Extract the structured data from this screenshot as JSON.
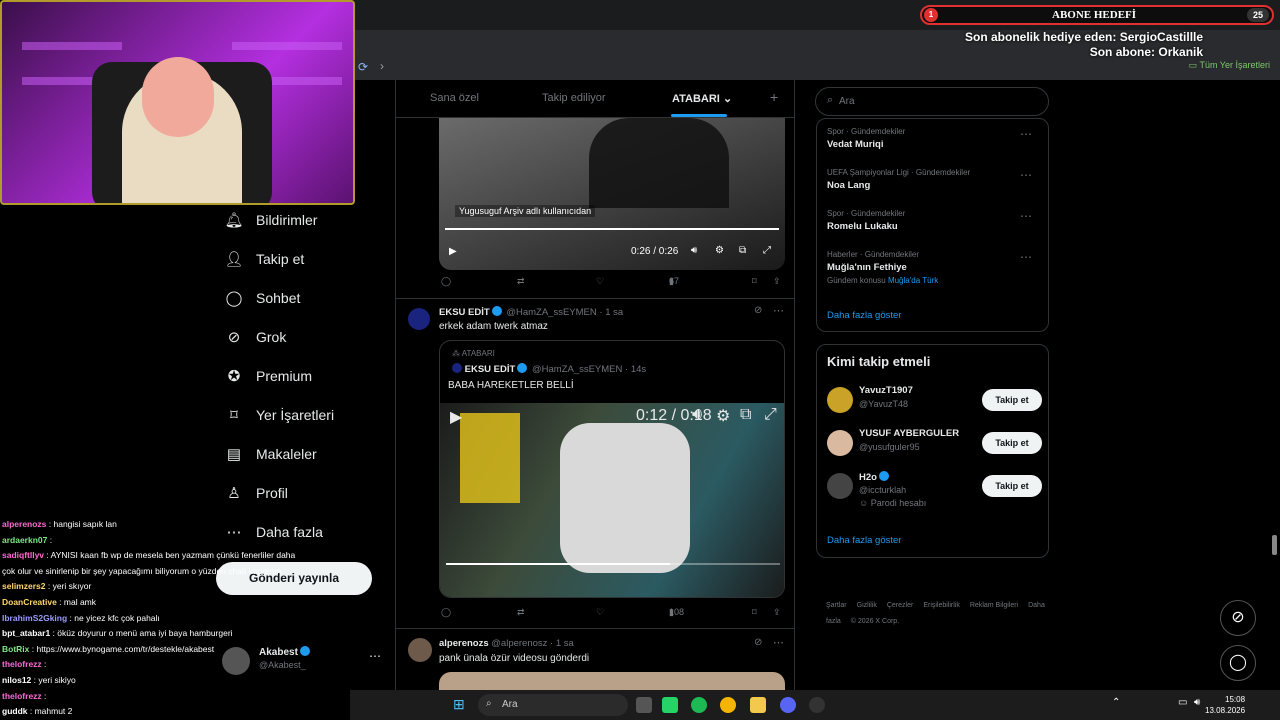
{
  "browser": {
    "bookmarks_label": "Tüm Yer İşaretleri"
  },
  "leftnav": {
    "items": [
      {
        "label": "Bildirimler",
        "icon": "bell-icon"
      },
      {
        "label": "Takip et",
        "icon": "person-plus-icon"
      },
      {
        "label": "Sohbet",
        "icon": "chat-bubble-icon"
      },
      {
        "label": "Grok",
        "icon": "grok-icon"
      },
      {
        "label": "Premium",
        "icon": "premium-check-icon"
      },
      {
        "label": "Yer İşaretleri",
        "icon": "bookmark-icon"
      },
      {
        "label": "Makaleler",
        "icon": "article-icon"
      },
      {
        "label": "Profil",
        "icon": "profile-icon"
      },
      {
        "label": "Daha fazla",
        "icon": "more-circle-icon"
      }
    ],
    "post_button": "Gönderi yayınla",
    "account": {
      "name": "Akabest",
      "handle": "@Akabest_"
    }
  },
  "chat": [
    {
      "user": "alperenozs",
      "color": "#ff6ad5",
      "text": " : hangisi sapık lan"
    },
    {
      "user": "ardaerkn07",
      "color": "#7ee787",
      "text": " : "
    },
    {
      "user": "sadiqftllyv",
      "color": "#ff6ad5",
      "text": " : AYNISI kaan fb wp de mesela ben yazmam çünkü fenerliler daha"
    },
    {
      "user": "",
      "color": "#fff",
      "text": "çok olur ve sinirlenip bir şey yapacağımı biliyorum o yüzden chati kapamm"
    },
    {
      "user": "selimzers2",
      "color": "#ffd86b",
      "text": " : yeri skıyor"
    },
    {
      "user": "DoanCreative",
      "color": "#ffd86b",
      "text": " : mal amk"
    },
    {
      "user": "IbrahimS2Gking",
      "color": "#9b9bff",
      "text": " : ne yicez kfc çok pahalı"
    },
    {
      "user": "bpt_atabar1",
      "color": "#fff",
      "text": " : öküz doyurur o menü ama iyi baya hamburgeri"
    },
    {
      "user": "BotRix",
      "color": "#7ee787",
      "text": " : https://www.bynogame.com/tr/destekle/akabest"
    },
    {
      "user": "thelofrezz",
      "color": "#ff6ad5",
      "text": " : "
    },
    {
      "user": "nilos12",
      "color": "#fff",
      "text": " : yeri sikiyo"
    },
    {
      "user": "thelofrezz",
      "color": "#ff6ad5",
      "text": " : "
    },
    {
      "user": "guddk",
      "color": "#fff",
      "text": " : mahmut 2"
    }
  ],
  "timeline": {
    "tabs": [
      "Sana özel",
      "Takip ediliyor",
      "ATABARI"
    ],
    "add_tab_icon": "plus-icon",
    "video1": {
      "watermark": "Yugusuguf Arşiv adlı kullanıcıdan",
      "time": "0:26 / 0:26",
      "progress": 1.0,
      "views": "67"
    },
    "tweet2": {
      "name": "EKSU EDİT",
      "handle": "@HamZA_ssEYMEN",
      "time": "· 1 sa",
      "text": "erkek adam twerk atmaz",
      "quote": {
        "community": "ATABARI",
        "name": "EKSU EDİT",
        "handle": "@HamZA_ssEYMEN",
        "time": "· 14s",
        "text": "BABA HAREKETLER BELLİ"
      },
      "video_time": "0:12 / 0:18",
      "progress": 0.67,
      "views": "108"
    },
    "tweet3": {
      "name": "alperenozs",
      "handle": "@alperenosz",
      "time": "· 1 sa",
      "text": "pank ünala özür videosu gönderdi"
    }
  },
  "sidebar": {
    "search_placeholder": "Ara",
    "trends": [
      {
        "meta": "Spor · Gündemdekiler",
        "name": "Vedat Muriqi",
        "sub": ""
      },
      {
        "meta": "UEFA Şampiyonlar Ligi · Gündemdekiler",
        "name": "Noa Lang",
        "sub": ""
      },
      {
        "meta": "Spor · Gündemdekiler",
        "name": "Romelu Lukaku",
        "sub": ""
      },
      {
        "meta": "Haberler · Gündemdekiler",
        "name": "Muğla'nın Fethiye",
        "sub": "Gündem konusu",
        "sub_link": "Muğla'da Türk"
      }
    ],
    "trends_more": "Daha fazla göster",
    "who_title": "Kimi takip etmeli",
    "who": [
      {
        "name": "YavuzT1907",
        "handle": "@YavuzT48",
        "extra": ""
      },
      {
        "name": "YUSUF AYBERGULER",
        "handle": "@yusufguler95",
        "extra": ""
      },
      {
        "name": "H2o",
        "handle": "@iccturklah",
        "extra": "Parodi hesabı"
      }
    ],
    "follow_label": "Takip et",
    "who_more": "Daha fazla göster",
    "footer": [
      "Şartlar",
      "Gizlilik",
      "Çerezler",
      "Erişilebilirlik",
      "Reklam Bilgileri",
      "Daha fazla",
      "© 2026 X Corp."
    ]
  },
  "overlay": {
    "goal_title": "ABONE HEDEFİ",
    "goal_current": "1",
    "goal_target": "25",
    "last_gift": "Son abonelik hediye eden: SergioCastillle",
    "last_sub": "Son abone: Orkanik"
  },
  "taskbar": {
    "search": "Ara",
    "time": "15:08",
    "date": "13.08.2026"
  }
}
